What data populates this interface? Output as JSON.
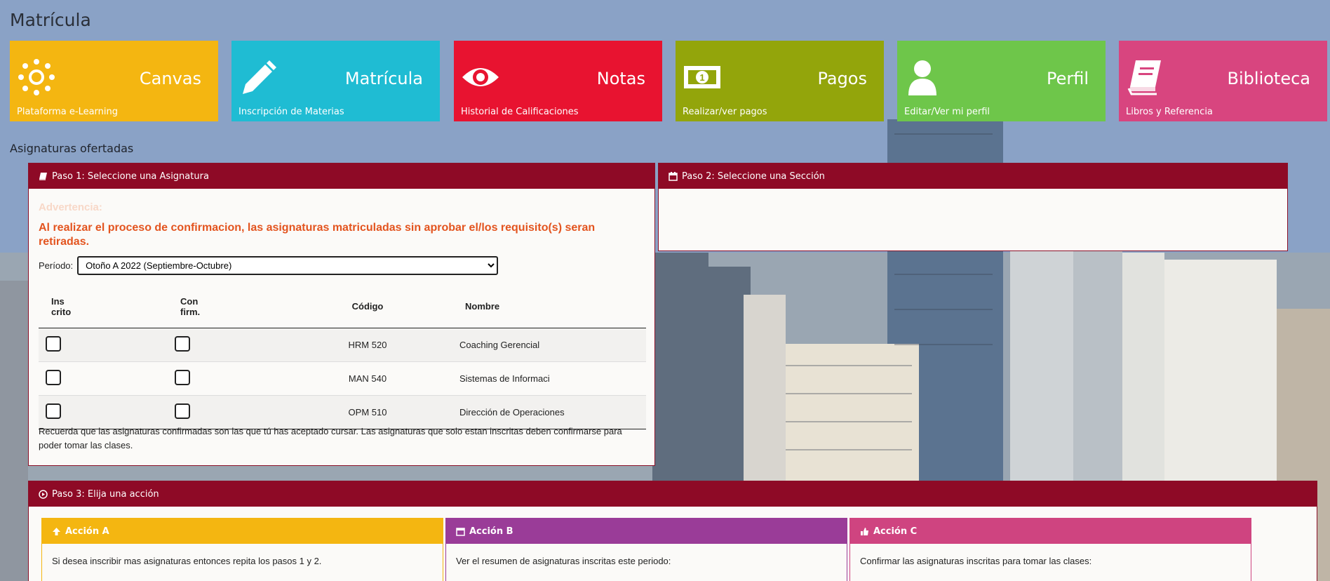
{
  "page": {
    "title": "Matrícula",
    "section_label": "Asignaturas ofertadas"
  },
  "tiles": [
    {
      "title": "Canvas",
      "subtitle": "Plataforma e-Learning",
      "color": "#f4b611",
      "icon": "canvas-icon"
    },
    {
      "title": "Matrícula",
      "subtitle": "Inscripción de Materias",
      "color": "#1fbcd3",
      "icon": "pencil-icon"
    },
    {
      "title": "Notas",
      "subtitle": "Historial de Calificaciones",
      "color": "#e81330",
      "icon": "eye-icon"
    },
    {
      "title": "Pagos",
      "subtitle": "Realizar/ver pagos",
      "color": "#93a50b",
      "icon": "money-icon"
    },
    {
      "title": "Perfil",
      "subtitle": "Editar/Ver mi perfil",
      "color": "#6ec64a",
      "icon": "user-icon"
    },
    {
      "title": "Biblioteca",
      "subtitle": "Libros y Referencia",
      "color": "#d8457f",
      "icon": "book-icon"
    }
  ],
  "step1": {
    "header": "Paso 1: Seleccione una Asignatura",
    "warning_title": "Advertencia:",
    "warning_text": "Al realizar el proceso de confirmacion, las asignaturas matriculadas sin aprobar el/los requisito(s) seran retiradas.",
    "period_label": "Período:",
    "period_value": "Otoño A 2022 (Septiembre-Octubre)",
    "columns": {
      "inscrito_1": "Ins",
      "inscrito_2": "crito",
      "confirm_1": "Con",
      "confirm_2": "firm.",
      "code": "Código",
      "name": "Nombre"
    },
    "rows": [
      {
        "code": "HRM 520",
        "name": "Coaching Gerencial"
      },
      {
        "code": "MAN 540",
        "name": "Sistemas de Informaci"
      },
      {
        "code": "OPM 510",
        "name": "Dirección de Operaciones"
      }
    ],
    "note": "Recuerda que las asignaturas confirmadas son las que tú has aceptado cursar. Las asignaturas que solo estan inscritas deben confirmarse para poder tomar las clases."
  },
  "step2": {
    "header": "Paso 2: Seleccione una Sección"
  },
  "step3": {
    "header": "Paso 3: Elija una acción",
    "actions": [
      {
        "title": "Acción A",
        "text": "Si desea inscribir mas asignaturas entonces repita los pasos 1 y 2.",
        "color": "#f4b611"
      },
      {
        "title": "Acción B",
        "text": "Ver el resumen de asignaturas inscritas este periodo:",
        "color": "#9a3c98"
      },
      {
        "title": "Acción C",
        "text": "Confirmar las asignaturas inscritas para tomar las clases:",
        "color": "#cf4480"
      }
    ]
  },
  "colors": {
    "panel_header": "#8e0a26",
    "warning": "#e3541f"
  }
}
